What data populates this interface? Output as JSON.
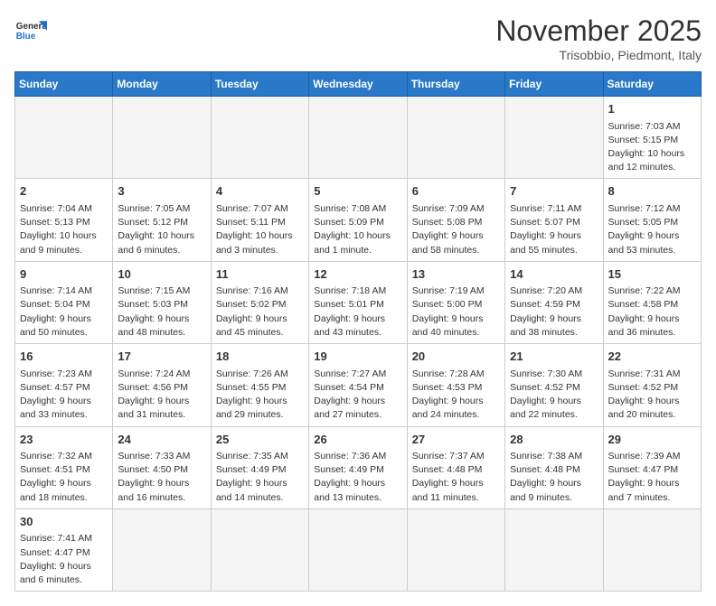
{
  "logo": {
    "general": "General",
    "blue": "Blue"
  },
  "title": "November 2025",
  "subtitle": "Trisobbio, Piedmont, Italy",
  "days_of_week": [
    "Sunday",
    "Monday",
    "Tuesday",
    "Wednesday",
    "Thursday",
    "Friday",
    "Saturday"
  ],
  "weeks": [
    [
      {
        "day": "",
        "data": ""
      },
      {
        "day": "",
        "data": ""
      },
      {
        "day": "",
        "data": ""
      },
      {
        "day": "",
        "data": ""
      },
      {
        "day": "",
        "data": ""
      },
      {
        "day": "",
        "data": ""
      },
      {
        "day": "1",
        "data": "Sunrise: 7:03 AM\nSunset: 5:15 PM\nDaylight: 10 hours and 12 minutes."
      }
    ],
    [
      {
        "day": "2",
        "data": "Sunrise: 7:04 AM\nSunset: 5:13 PM\nDaylight: 10 hours and 9 minutes."
      },
      {
        "day": "3",
        "data": "Sunrise: 7:05 AM\nSunset: 5:12 PM\nDaylight: 10 hours and 6 minutes."
      },
      {
        "day": "4",
        "data": "Sunrise: 7:07 AM\nSunset: 5:11 PM\nDaylight: 10 hours and 3 minutes."
      },
      {
        "day": "5",
        "data": "Sunrise: 7:08 AM\nSunset: 5:09 PM\nDaylight: 10 hours and 1 minute."
      },
      {
        "day": "6",
        "data": "Sunrise: 7:09 AM\nSunset: 5:08 PM\nDaylight: 9 hours and 58 minutes."
      },
      {
        "day": "7",
        "data": "Sunrise: 7:11 AM\nSunset: 5:07 PM\nDaylight: 9 hours and 55 minutes."
      },
      {
        "day": "8",
        "data": "Sunrise: 7:12 AM\nSunset: 5:05 PM\nDaylight: 9 hours and 53 minutes."
      }
    ],
    [
      {
        "day": "9",
        "data": "Sunrise: 7:14 AM\nSunset: 5:04 PM\nDaylight: 9 hours and 50 minutes."
      },
      {
        "day": "10",
        "data": "Sunrise: 7:15 AM\nSunset: 5:03 PM\nDaylight: 9 hours and 48 minutes."
      },
      {
        "day": "11",
        "data": "Sunrise: 7:16 AM\nSunset: 5:02 PM\nDaylight: 9 hours and 45 minutes."
      },
      {
        "day": "12",
        "data": "Sunrise: 7:18 AM\nSunset: 5:01 PM\nDaylight: 9 hours and 43 minutes."
      },
      {
        "day": "13",
        "data": "Sunrise: 7:19 AM\nSunset: 5:00 PM\nDaylight: 9 hours and 40 minutes."
      },
      {
        "day": "14",
        "data": "Sunrise: 7:20 AM\nSunset: 4:59 PM\nDaylight: 9 hours and 38 minutes."
      },
      {
        "day": "15",
        "data": "Sunrise: 7:22 AM\nSunset: 4:58 PM\nDaylight: 9 hours and 36 minutes."
      }
    ],
    [
      {
        "day": "16",
        "data": "Sunrise: 7:23 AM\nSunset: 4:57 PM\nDaylight: 9 hours and 33 minutes."
      },
      {
        "day": "17",
        "data": "Sunrise: 7:24 AM\nSunset: 4:56 PM\nDaylight: 9 hours and 31 minutes."
      },
      {
        "day": "18",
        "data": "Sunrise: 7:26 AM\nSunset: 4:55 PM\nDaylight: 9 hours and 29 minutes."
      },
      {
        "day": "19",
        "data": "Sunrise: 7:27 AM\nSunset: 4:54 PM\nDaylight: 9 hours and 27 minutes."
      },
      {
        "day": "20",
        "data": "Sunrise: 7:28 AM\nSunset: 4:53 PM\nDaylight: 9 hours and 24 minutes."
      },
      {
        "day": "21",
        "data": "Sunrise: 7:30 AM\nSunset: 4:52 PM\nDaylight: 9 hours and 22 minutes."
      },
      {
        "day": "22",
        "data": "Sunrise: 7:31 AM\nSunset: 4:52 PM\nDaylight: 9 hours and 20 minutes."
      }
    ],
    [
      {
        "day": "23",
        "data": "Sunrise: 7:32 AM\nSunset: 4:51 PM\nDaylight: 9 hours and 18 minutes."
      },
      {
        "day": "24",
        "data": "Sunrise: 7:33 AM\nSunset: 4:50 PM\nDaylight: 9 hours and 16 minutes."
      },
      {
        "day": "25",
        "data": "Sunrise: 7:35 AM\nSunset: 4:49 PM\nDaylight: 9 hours and 14 minutes."
      },
      {
        "day": "26",
        "data": "Sunrise: 7:36 AM\nSunset: 4:49 PM\nDaylight: 9 hours and 13 minutes."
      },
      {
        "day": "27",
        "data": "Sunrise: 7:37 AM\nSunset: 4:48 PM\nDaylight: 9 hours and 11 minutes."
      },
      {
        "day": "28",
        "data": "Sunrise: 7:38 AM\nSunset: 4:48 PM\nDaylight: 9 hours and 9 minutes."
      },
      {
        "day": "29",
        "data": "Sunrise: 7:39 AM\nSunset: 4:47 PM\nDaylight: 9 hours and 7 minutes."
      }
    ],
    [
      {
        "day": "30",
        "data": "Sunrise: 7:41 AM\nSunset: 4:47 PM\nDaylight: 9 hours and 6 minutes."
      },
      {
        "day": "",
        "data": ""
      },
      {
        "day": "",
        "data": ""
      },
      {
        "day": "",
        "data": ""
      },
      {
        "day": "",
        "data": ""
      },
      {
        "day": "",
        "data": ""
      },
      {
        "day": "",
        "data": ""
      }
    ]
  ]
}
